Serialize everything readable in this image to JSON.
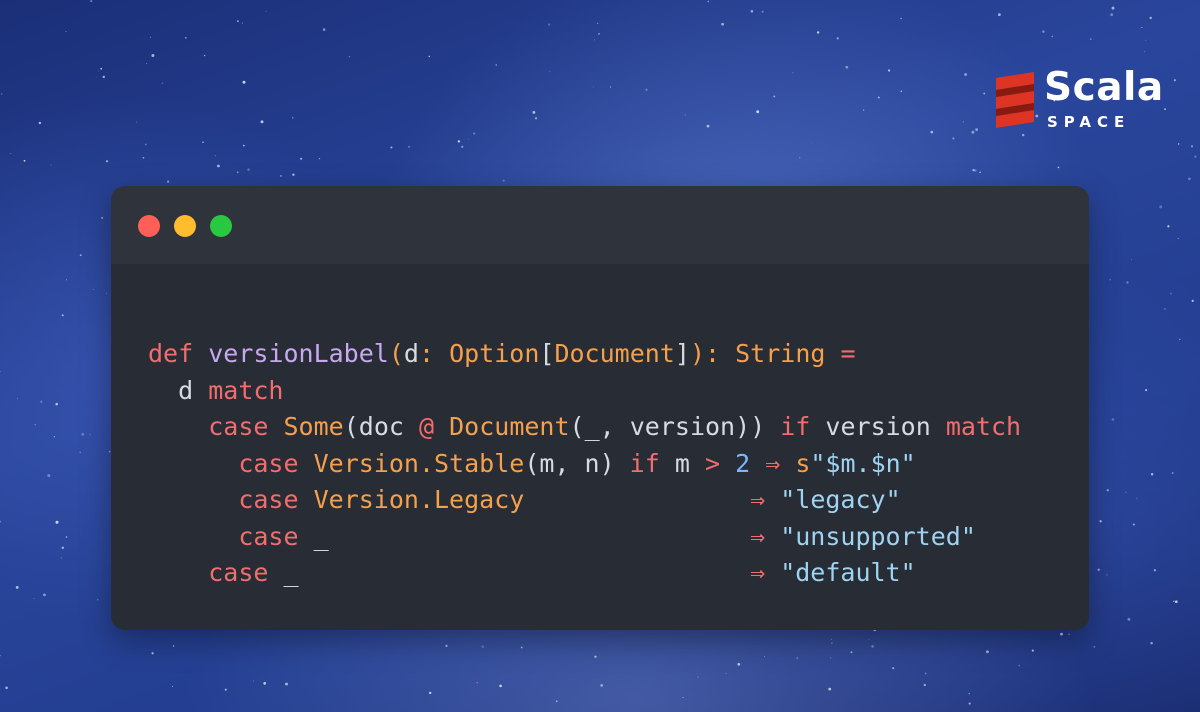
{
  "brand": {
    "name": "Scala",
    "subtitle": "SPACE"
  },
  "window": {
    "controls": [
      "close",
      "minimize",
      "maximize"
    ]
  },
  "code": {
    "language": "scala",
    "lines": [
      [
        {
          "t": "def",
          "c": "kw"
        },
        {
          "t": " ",
          "c": "pl"
        },
        {
          "t": "versionLabel",
          "c": "fn"
        },
        {
          "t": "(",
          "c": "ty"
        },
        {
          "t": "d",
          "c": "pl"
        },
        {
          "t": ": ",
          "c": "ty"
        },
        {
          "t": "Option",
          "c": "ty"
        },
        {
          "t": "[",
          "c": "pl"
        },
        {
          "t": "Document",
          "c": "ty"
        },
        {
          "t": "]",
          "c": "pl"
        },
        {
          "t": "):",
          "c": "ty"
        },
        {
          "t": " ",
          "c": "pl"
        },
        {
          "t": "String",
          "c": "ty"
        },
        {
          "t": " =",
          "c": "kw"
        }
      ],
      [
        {
          "t": "  d ",
          "c": "pl"
        },
        {
          "t": "match",
          "c": "kw"
        }
      ],
      [
        {
          "t": "    ",
          "c": "pl"
        },
        {
          "t": "case",
          "c": "kw"
        },
        {
          "t": " ",
          "c": "pl"
        },
        {
          "t": "Some",
          "c": "ty"
        },
        {
          "t": "(doc ",
          "c": "pl"
        },
        {
          "t": "@",
          "c": "kw"
        },
        {
          "t": " ",
          "c": "pl"
        },
        {
          "t": "Document",
          "c": "ty"
        },
        {
          "t": "(_, version)) ",
          "c": "pl"
        },
        {
          "t": "if",
          "c": "kw"
        },
        {
          "t": " version ",
          "c": "pl"
        },
        {
          "t": "match",
          "c": "kw"
        }
      ],
      [
        {
          "t": "      ",
          "c": "pl"
        },
        {
          "t": "case",
          "c": "kw"
        },
        {
          "t": " ",
          "c": "pl"
        },
        {
          "t": "Version.Stable",
          "c": "ty"
        },
        {
          "t": "(m, n) ",
          "c": "pl"
        },
        {
          "t": "if",
          "c": "kw"
        },
        {
          "t": " m ",
          "c": "pl"
        },
        {
          "t": ">",
          "c": "op"
        },
        {
          "t": " ",
          "c": "pl"
        },
        {
          "t": "2",
          "c": "nu"
        },
        {
          "t": " ",
          "c": "pl"
        },
        {
          "t": "⇒",
          "c": "op"
        },
        {
          "t": " ",
          "c": "pl"
        },
        {
          "t": "s",
          "c": "ty"
        },
        {
          "t": "\"$m.$n\"",
          "c": "st"
        }
      ],
      [
        {
          "t": "      ",
          "c": "pl"
        },
        {
          "t": "case",
          "c": "kw"
        },
        {
          "t": " ",
          "c": "pl"
        },
        {
          "t": "Version.Legacy",
          "c": "ty"
        },
        {
          "t": "               ",
          "c": "pl"
        },
        {
          "t": "⇒",
          "c": "op"
        },
        {
          "t": " ",
          "c": "pl"
        },
        {
          "t": "\"legacy\"",
          "c": "st"
        }
      ],
      [
        {
          "t": "      ",
          "c": "pl"
        },
        {
          "t": "case",
          "c": "kw"
        },
        {
          "t": " _                            ",
          "c": "pl"
        },
        {
          "t": "⇒",
          "c": "op"
        },
        {
          "t": " ",
          "c": "pl"
        },
        {
          "t": "\"unsupported\"",
          "c": "st"
        }
      ],
      [
        {
          "t": "    ",
          "c": "pl"
        },
        {
          "t": "case",
          "c": "kw"
        },
        {
          "t": " _                              ",
          "c": "pl"
        },
        {
          "t": "⇒",
          "c": "op"
        },
        {
          "t": " ",
          "c": "pl"
        },
        {
          "t": "\"default\"",
          "c": "st"
        }
      ]
    ]
  },
  "colors": {
    "background": "#233e90",
    "window_body": "#282c34",
    "window_titlebar": "#2f333b",
    "close_dot": "#ff5f57",
    "minimize_dot": "#febc2e",
    "maximize_dot": "#28c840",
    "keyword": "#f26d6d",
    "function": "#c8a8f0",
    "type": "#f5a04c",
    "plain": "#d6dae1",
    "string": "#9ed3f2",
    "number": "#79b8ff",
    "logo_red": "#de3423"
  },
  "icons": {
    "logo": "scala-logo-icon"
  }
}
